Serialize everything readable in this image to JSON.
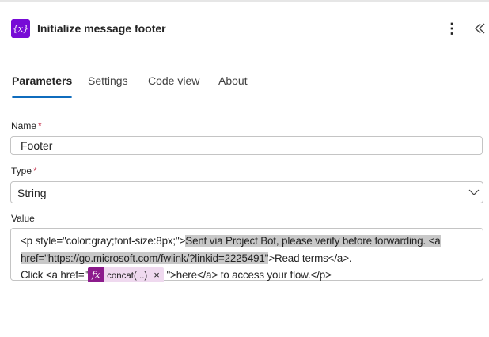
{
  "header": {
    "icon_text": "{x}",
    "title": "Initialize message footer",
    "more_icon": "⋮",
    "collapse_icon": "double-chevron-left-icon"
  },
  "tabs": [
    {
      "label": "Parameters",
      "active": true
    },
    {
      "label": "Settings",
      "active": false
    },
    {
      "label": "Code view",
      "active": false
    },
    {
      "label": "About",
      "active": false
    }
  ],
  "fields": {
    "name": {
      "label": "Name",
      "required": "*",
      "value": "Footer"
    },
    "type": {
      "label": "Type",
      "required": "*",
      "value": "String"
    },
    "value": {
      "label": "Value",
      "line1_plain": "<p style=\"color:gray;font-size:8px;\">",
      "line1_selected": "Sent via Project Bot, please verify before forwarding. <a",
      "line2_selected": "href=\"https://go.microsoft.com/fwlink/?linkid=2225491\"",
      "line2_plain": ">Read terms</a>.",
      "line3_prefix": "Click <a href=\"",
      "token_icon": "fx",
      "token_label": "concat(...)",
      "token_close": "×",
      "line3_suffix": "\">here</a> to access your flow.</p>"
    }
  },
  "colors": {
    "accent": "#0f6cbd",
    "app_icon_bg": "#770bd6",
    "token_bg": "#efd9ef",
    "token_icon_bg": "#8c1b8c",
    "selection_bg": "#c8c8c8",
    "required": "#c4314b"
  }
}
